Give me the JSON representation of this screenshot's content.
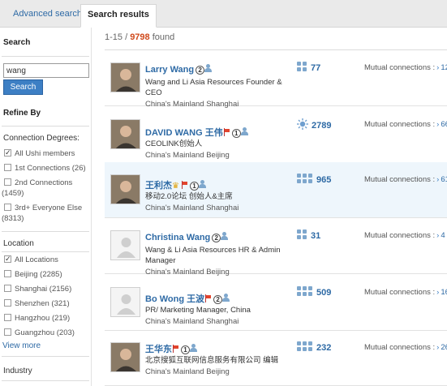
{
  "tabs": {
    "advanced": "Advanced search",
    "results": "Search results"
  },
  "sidebar": {
    "search_title": "Search",
    "search_value": "wang",
    "search_button": "Search",
    "refine_title": "Refine By",
    "connection_title": "Connection Degrees:",
    "connection_options": [
      {
        "label": "All Ushi members",
        "checked": true
      },
      {
        "label": "1st Connections (26)",
        "checked": false
      },
      {
        "label": "2nd Connections",
        "label2": "(1459)",
        "checked": false
      },
      {
        "label": "3rd+ Everyone Else",
        "label2": "(8313)",
        "checked": false
      }
    ],
    "location_title": "Location",
    "location_options": [
      {
        "label": "All Locations",
        "checked": true
      },
      {
        "label": "Beijing (2285)",
        "checked": false
      },
      {
        "label": "Shanghai (2156)",
        "checked": false
      },
      {
        "label": "Shenzhen (321)",
        "checked": false
      },
      {
        "label": "Hangzhou (219)",
        "checked": false
      },
      {
        "label": "Guangzhou (203)",
        "checked": false
      }
    ],
    "view_more": "View more",
    "industry_title": "Industry"
  },
  "results": {
    "range": "1-15 / ",
    "total": "9798",
    "found": " found",
    "mutual_label": "Mutual connections :",
    "arrow": "›",
    "items": [
      {
        "name": "Larry Wang",
        "degree": "2",
        "title": "Wang and Li Asia Resources Founder & CEO",
        "location": "China's Mainland Shanghai",
        "connections": "77",
        "mutual": "12",
        "flag": false,
        "crown": false,
        "avatar": "photo",
        "conn_icon": "group"
      },
      {
        "name": "DAVID WANG 王伟",
        "degree": "1",
        "title": "CEOLINK创始人",
        "location": "China's Mainland Beijing",
        "connections": "2789",
        "mutual": "66",
        "flag": true,
        "crown": false,
        "avatar": "photo",
        "conn_icon": "sun"
      },
      {
        "name": "王利杰",
        "degree": "1",
        "title": "移动2.0论坛 创始人&主席",
        "location": "China's Mainland Shanghai",
        "connections": "965",
        "mutual": "61",
        "flag": true,
        "crown": true,
        "avatar": "photo",
        "conn_icon": "group-large"
      },
      {
        "name": "Christina Wang",
        "degree": "2",
        "title": "Wang & Li Asia Resources HR & Admin Manager",
        "location": "China's Mainland Beijing",
        "connections": "31",
        "mutual": "4",
        "flag": false,
        "crown": false,
        "avatar": "placeholder",
        "conn_icon": "group"
      },
      {
        "name": "Bo Wong 王波",
        "degree": "2",
        "title": "PR/ Marketing Manager, China",
        "location": "China's Mainland Shanghai",
        "connections": "509",
        "mutual": "16",
        "flag": true,
        "crown": false,
        "avatar": "placeholder",
        "conn_icon": "group-large"
      },
      {
        "name": "王华东",
        "degree": "1",
        "title": "北京搜狐互联网信息服务有限公司 编辑",
        "location": "China's Mainland Beijing",
        "connections": "232",
        "mutual": "26",
        "flag": true,
        "crown": false,
        "avatar": "photo",
        "conn_icon": "group-large"
      }
    ]
  }
}
